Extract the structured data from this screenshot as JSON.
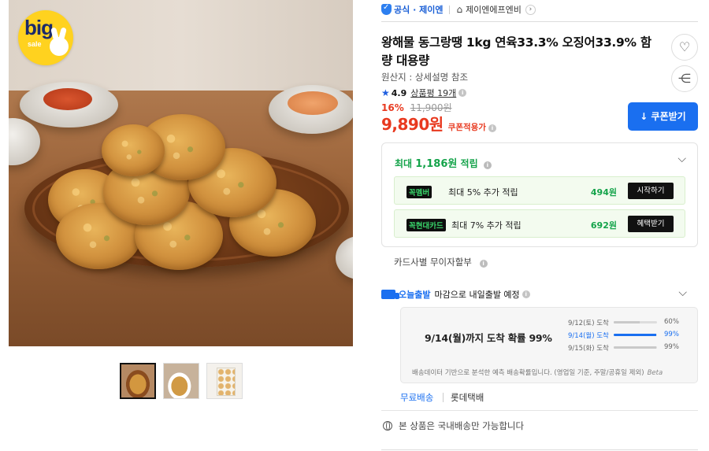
{
  "badge": {
    "big": "big",
    "sale": "sale"
  },
  "store_bar": {
    "official": "공식 · 제이엔",
    "store_name": "제이엔에프엔비",
    "chevron": "›"
  },
  "product": {
    "title": "왕해물 동그랑땡 1kg 연육33.3% 오징어33.9% 함량 대용량",
    "origin": "원산지 : 상세설명 참조",
    "rating": "4.9",
    "review_link": "상품평 19개",
    "discount_pct": "16%",
    "original_price": "11,900원",
    "price": "9,890원",
    "coupon_applied": "쿠폰적용가",
    "coupon_button": "쿠폰받기"
  },
  "rewards": {
    "headline_prefix": "최대 ",
    "headline_amount": "1,186원",
    "headline_suffix": " 적립",
    "items": [
      {
        "tag": "꼭멤버",
        "desc": "최대 5% 추가 적립",
        "amount": "494원",
        "action": "시작하기"
      },
      {
        "tag": "꼭현대카드",
        "desc": "최대 7% 추가 적립",
        "amount": "692원",
        "action": "혜택받기"
      }
    ]
  },
  "card_installment": "카드사별 무이자할부",
  "shipping": {
    "today_label": "오늘출발",
    "today_desc": "마감으로 내일출발 예정",
    "headline": "9/14(월)까지 도착 확률 99%",
    "probabilities": [
      {
        "date": "9/12(토) 도착",
        "value": 60,
        "label": "60%"
      },
      {
        "date": "9/14(월) 도착",
        "value": 99,
        "label": "99%"
      },
      {
        "date": "9/15(화) 도착",
        "value": 99,
        "label": "99%"
      }
    ],
    "note": "배송데이터 기반으로 분석한 예측 배송확률입니다. (영업일 기준, 주말/공휴일 제외)",
    "beta": "Beta",
    "free_shipping": "무료배송",
    "carrier": "롯데택배",
    "domestic_only": "본 상품은 국내배송만 가능합니다"
  },
  "icons": {
    "heart": "♡",
    "share": "⋲",
    "download": "↓",
    "chevron_down": "⌵",
    "home": "⌂",
    "star": "★",
    "info": "i"
  },
  "colors": {
    "accent_blue": "#1a6ff0",
    "price_red": "#e8391f",
    "reward_green": "#14a34a"
  }
}
